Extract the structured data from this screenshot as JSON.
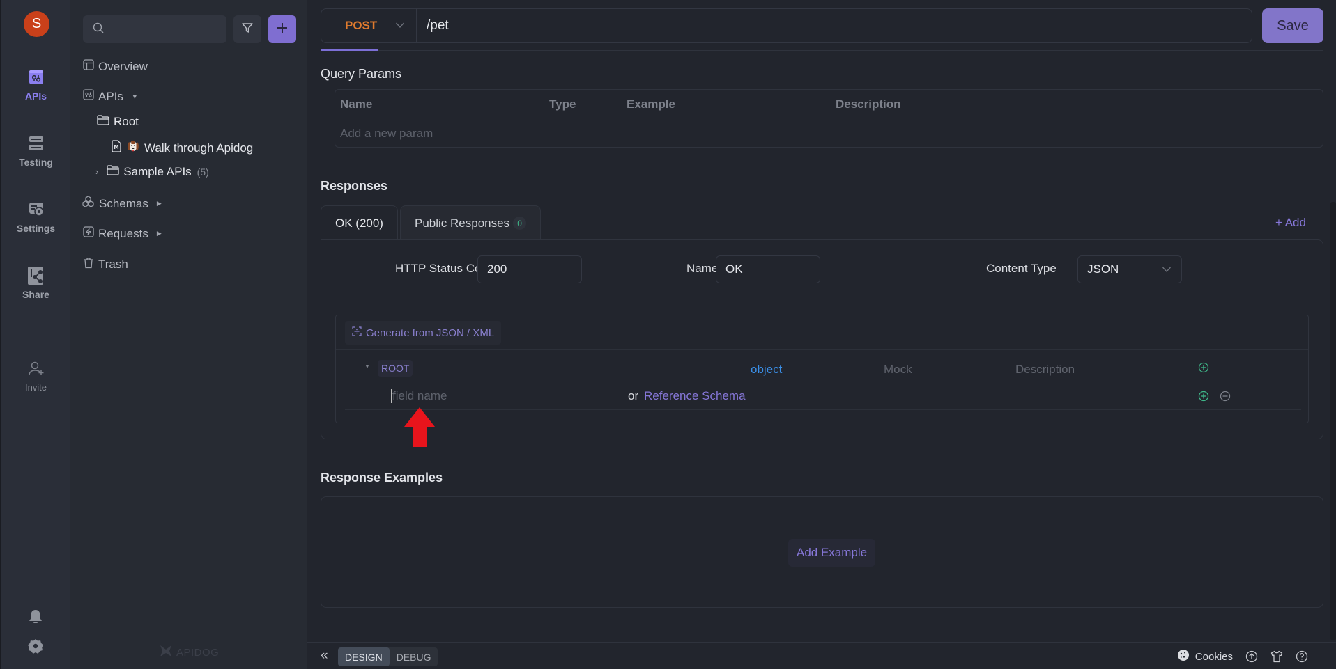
{
  "rail": {
    "avatar_letter": "S",
    "items": [
      {
        "label": "APIs",
        "icon": "apis-icon",
        "active": true
      },
      {
        "label": "Testing",
        "icon": "testing-icon",
        "active": false
      },
      {
        "label": "Settings",
        "icon": "settings-icon",
        "active": false
      },
      {
        "label": "Share",
        "icon": "share-icon",
        "active": false
      }
    ],
    "invite_label": "Invite",
    "bottom_icons": [
      "bell-icon",
      "gear-icon"
    ]
  },
  "tree": {
    "search_placeholder": "",
    "items": {
      "overview": "Overview",
      "apis": "APIs",
      "root": "Root",
      "walk": "Walk through Apidog",
      "sample": "Sample APIs",
      "sample_count": "(5)",
      "schemas": "Schemas",
      "requests": "Requests",
      "trash": "Trash"
    },
    "brand": "APIDOG"
  },
  "endpoint": {
    "method": "POST",
    "path": "/pet",
    "save_label": "Save"
  },
  "colors": {
    "accent": "#7f6ed1",
    "method_post": "#e07b2e",
    "type_object": "#3a8ee6",
    "add_green": "#3fb88a"
  },
  "query_params": {
    "title": "Query Params",
    "columns": [
      "Name",
      "Type",
      "Example",
      "Description"
    ],
    "add_placeholder": "Add a new param"
  },
  "responses": {
    "title": "Responses",
    "tabs": [
      {
        "label": "OK (200)",
        "active": true
      },
      {
        "label": "Public Responses",
        "badge": "0",
        "active": false
      }
    ],
    "add_label": "+ Add",
    "status_code_label": "HTTP Status Code",
    "status_code_value": "200",
    "name_label": "Name",
    "name_value": "OK",
    "content_type_label": "Content Type",
    "content_type_value": "JSON",
    "schema": {
      "generate_label": "Generate from JSON / XML",
      "root_label": "ROOT",
      "root_type": "object",
      "mock_placeholder": "Mock",
      "description_placeholder": "Description",
      "field_placeholder": "field name",
      "or_label": "or",
      "reference_label": "Reference Schema"
    }
  },
  "examples": {
    "title": "Response Examples",
    "add_label": "Add Example"
  },
  "bottom": {
    "modes": [
      {
        "label": "DESIGN",
        "active": true
      },
      {
        "label": "DEBUG",
        "active": false
      }
    ],
    "cookies_label": "Cookies"
  }
}
